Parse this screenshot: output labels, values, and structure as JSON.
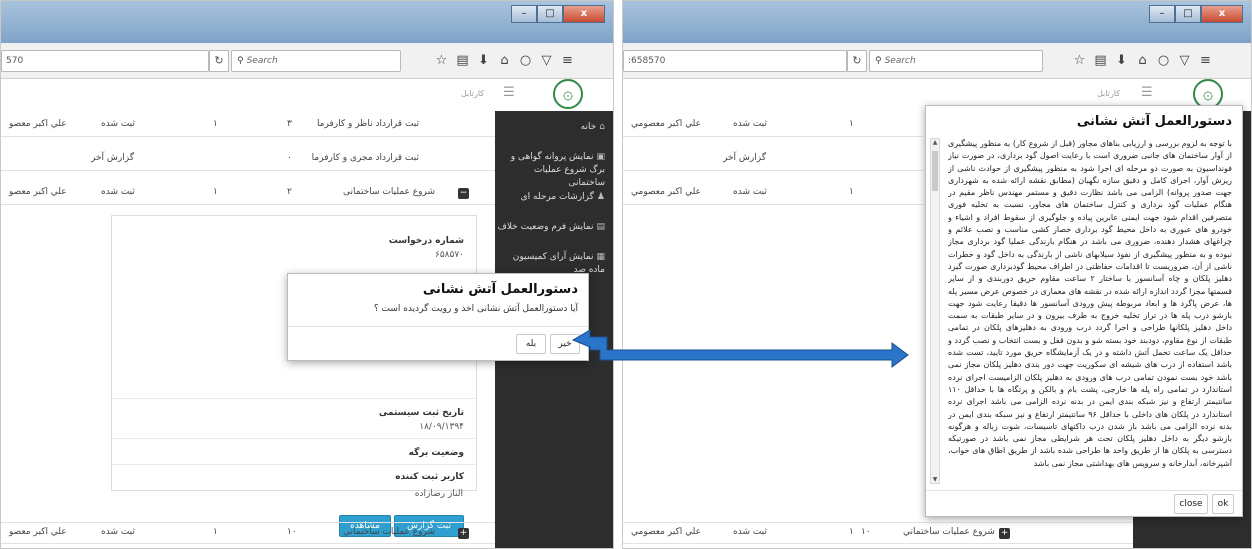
{
  "browser": {
    "left_url": "570",
    "right_url": ":658570",
    "search_placeholder": "Search",
    "window_minimize": "–",
    "window_maximize": "□",
    "window_close": "x"
  },
  "app": {
    "name": "کارتابل",
    "logo": "۞"
  },
  "sidebar": {
    "items": [
      {
        "label": "خانه",
        "icon": "home-icon"
      },
      {
        "label": "نمایش پروانه گواهی و",
        "label2": "برگ شروع عملیات ساختمانی",
        "icon": "certificate-icon"
      },
      {
        "label": "گزارشات مرحله ای",
        "icon": "reports-icon"
      },
      {
        "label": "نمایش فرم وضعیت خلاف",
        "icon": "violation-form-icon"
      },
      {
        "label": "نمایش آرای کمیسیون",
        "label2": "ماده صد",
        "icon": "commission-icon"
      }
    ]
  },
  "table": {
    "rows": [
      {
        "title": "ثبت قرارداد ناظر و کارفرما",
        "num": "۳",
        "count": "۱",
        "status": "ثبت شده",
        "user": "علي اكبر معصو"
      },
      {
        "title": "ثبت قرارداد مجری و کارفرما",
        "num": "۰",
        "count": "",
        "status": "گزارش آخر",
        "user": ""
      },
      {
        "title": "شروع عملیات ساختمانی",
        "num": "۲",
        "count": "۱",
        "status": "ثبت شده",
        "user": "علي اكبر معصو"
      },
      {
        "title": "شروع عملیات ساختمانی",
        "num": "۱۰",
        "count": "۱",
        "status": "ثبت شده",
        "user": "علي اكبر معصو"
      }
    ],
    "right_user": "علي اكبر معصومي",
    "right_last": "شروع عمليات ساختماني"
  },
  "detail": {
    "request_no_label": "شماره درخواست",
    "request_no_value": "۶۵۸۵۷۰",
    "system_date_label": "تاریخ ثبت سیستمی",
    "system_date_value": "۱۸/۰۹/۱۳۹۴",
    "sheet_status_label": "وضعیت برگه",
    "registrar_label": "کاربر ثبت کننده",
    "registrar_value": "الناز رضازاده",
    "view_button": "مشاهده",
    "report_button": "ثبت گزارش"
  },
  "confirm_modal": {
    "title": "دستورالعمل آتش نشانی",
    "message": "آیا دستورالعمل آتش نشانی اخذ و رویت گردیده است ؟",
    "no_button": "خیر",
    "yes_button": "بله"
  },
  "instruction_modal": {
    "title": "دستورالعمل آتش نشانی",
    "body": "با توجه به لزوم بررسی و ارزیابی بناهای مجاور (قبل از شروع کار) به منظور پیشگیری از آوار ساختمان های جانبی ضروری است با رعایت اصول گود برداری، در صورت نیاز فونداسیون به صورت دو مرحله ای اجرا شود به منظور پیشگیری از حوادث ناشی از ریزش آوار، اجرای کامل و دقیق سازه نگهبان (مطابق نقشه ارائه شده به شهرداری جهت صدور پروانه) الزامی می باشد نظارت دقیق و مستمر مهندس ناظر مقیم در هنگام عملیات گود برداری و کنترل ساختمان های مجاور، نسبت به تخلیه فوری متصرفین اقدام شود جهت ایمنی عابرین پیاده و جلوگیری از سقوط افراد و اشیاء و خودرو های عبوری به داخل محیط گود برداری حصار کشی مناسب و نصب علائم و چراغهای هشدار دهنده، ضروری می باشد در هنگام بارندگی عملیا گود برداری مجاز نبوده و به منظور پیشگیری از نفوذ سیلابهای ناشی از بارندگی به داخل گود و خطرات ناشی از آن، ضروریست تا اقدامات حفاظتی در اطراف محیط گودبرداری صورت گیرد دهلیز پلکان و چاه آسانسور با ساختار ۲ ساعت مقاوم حریق دوربندی و از سایر قسمتها مجزا گردد اندازه ارائه شده در نقشه های معماری در خصوص عرض مسیر پله ها، عرض پاگرد ها و ابعاد مربوطه پیش ورودی آسانسور ها دقیقا رعایت شود جهت بازشو درب پله ها در تراز تخلیه خروج به طرف بیرون و در سایر طبقات به سمت داخل دهلیز پلکانها طراحی و اجرا گردد درب ورودی به دهلیزهای پلکان در تمامی طبقات از نوع مقاوم، دودبند خود بسته شو و بدون قفل و بست انتخاب و نصب گردد و حداقل یک ساعت تحمل آتش داشته و در یک آزمایشگاه حریق مورد تایید، تست شده باشد استفاده از درب های شیشه ای سکوریت جهت دور بندی دهلیز پلکان مجاز نمی باشد خود بست نمودن تمامی درب های ورودی به دهلیز پلکان الزامیست اجرای نرده استاندارد در تمامی راه پله ها خارجی، پشت بام و بالکن و پرتگاه ها با حداقل ۱۱۰ سانتیمتر ارتفاع و نیز شبکه بندی ایمن در بدنه نرده الزامی می باشد اجرای نرده استاندارد در پلکان های داخلی با حداقل ۹۶ سانتیمتر ارتفاع و نیز سبکه بندی ایمن در بدنه نرده الزامی می باشد باز شدن درب داکتهای تاسیسات، شوت زباله و هرگونه بازشو دیگر به داخل دهلیز پلکان تحت هر شرایطی مجاز نمی باشد در صورتیکه دسترسی به پلکان ها از طریق واحد ها طراحی شده باشد از طریق اطاق های خواب، آشپزخانه، آبدارخانه و سرویس های بهداشتی مجاز نمی باشد",
    "close_button": "close",
    "ok_button": "ok"
  },
  "accent_colors": {
    "sidebar": "#2d2d2d",
    "primary_button": "#2f9fd0",
    "arrow": "#2a74c9"
  }
}
